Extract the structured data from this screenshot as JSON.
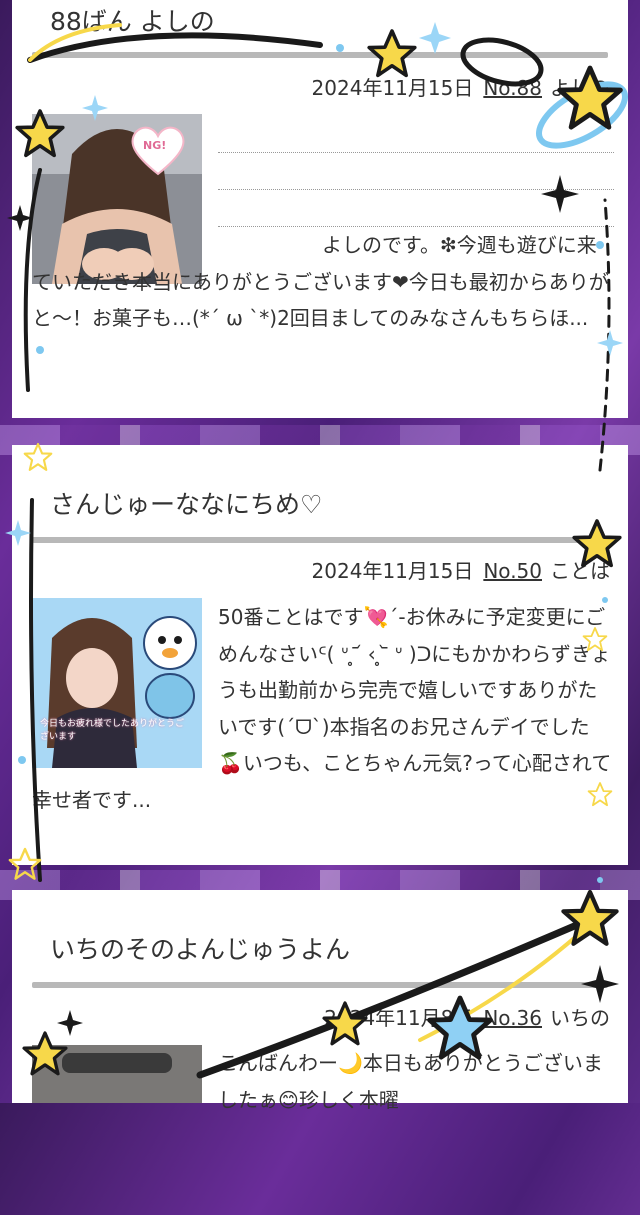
{
  "posts": [
    {
      "title": "88ばん よしの",
      "date": "2024年11月15日",
      "no": "No.88",
      "author": "よしの",
      "image_badge": "NG!",
      "excerpt": "よしのです。❇︎今週も遊びに来ていただき本当にありがとうございます❤︎今日も最初からありがと〜！お菓子も…(*ˊ ω ˋ*)2回目ましてのみなさんもちらほ..."
    },
    {
      "title": "さんじゅーななにちめ♡",
      "date": "2024年11月15日",
      "no": "No.50",
      "author": "ことは",
      "image_caption": "今日もお疲れ様でしたありがとうございます",
      "excerpt": "50番ことはです💘ˊ-お休みに予定変更にごめんなさいᑦ( ᐡ ̥ ᷄ ‹ ̥ ᷅ ᐡ )ᑐにもかかわらずきょうも出勤前から完売で嬉しいですありがたいです(ˊᗜˋ)本指名のお兄さんデイでした🍒いつも、ことちゃん元気?って心配されて幸せ者です..."
    },
    {
      "title": "いちのそのよんじゅうよん",
      "date": "2024年11月8日",
      "no": "No.36",
      "author": "いちの",
      "excerpt": "こんばんわー🌙本日もありがとうございましたぁ😊珍しく本曜"
    }
  ],
  "icons": [
    "star-icon",
    "sparkle-icon",
    "ring-icon",
    "shooting-star-icon",
    "heart-icon"
  ],
  "colors": {
    "star_yellow": "#f7d84a",
    "ring_blue": "#7ec8f0",
    "bg_purple": "#5a2a88",
    "rule_gray": "#b8b8b8"
  }
}
